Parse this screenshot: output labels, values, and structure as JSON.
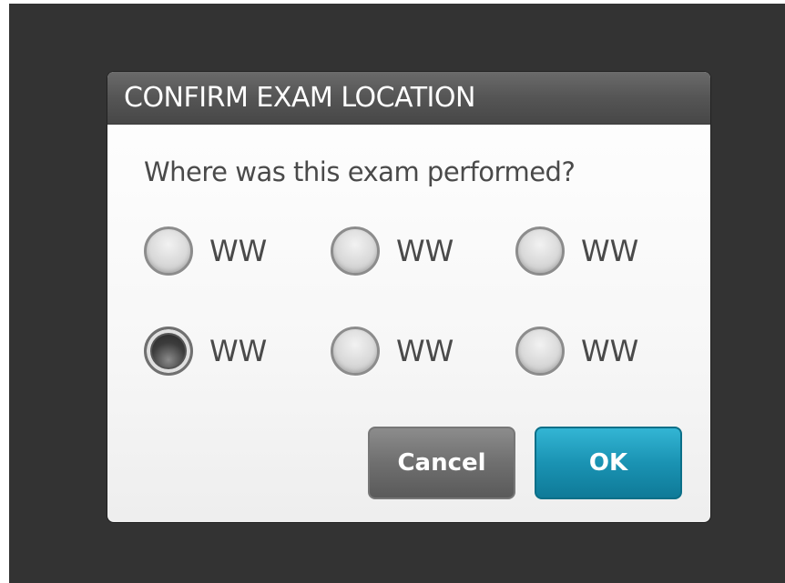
{
  "dialog": {
    "title": "CONFIRM EXAM LOCATION",
    "prompt": "Where was this exam performed?",
    "options": [
      {
        "label": "WW",
        "selected": false
      },
      {
        "label": "WW",
        "selected": false
      },
      {
        "label": "WW",
        "selected": false
      },
      {
        "label": "WW",
        "selected": true
      },
      {
        "label": "WW",
        "selected": false
      },
      {
        "label": "WW",
        "selected": false
      }
    ],
    "cancel_label": "Cancel",
    "ok_label": "OK"
  },
  "colors": {
    "background": "#333333",
    "title_bar": "#555555",
    "ok_button": "#1a93b3",
    "cancel_button": "#6f6f6f"
  }
}
